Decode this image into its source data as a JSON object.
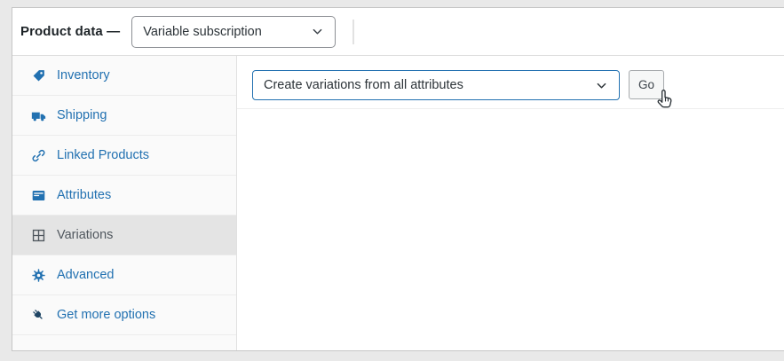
{
  "header": {
    "title": "Product data —",
    "product_type_select": {
      "value": "Variable subscription",
      "icon": "chevron-down-icon"
    }
  },
  "sidebar": {
    "items": [
      {
        "label": "Inventory",
        "icon": "tag-icon",
        "active": false
      },
      {
        "label": "Shipping",
        "icon": "truck-icon",
        "active": false
      },
      {
        "label": "Linked Products",
        "icon": "link-icon",
        "active": false
      },
      {
        "label": "Attributes",
        "icon": "form-card-icon",
        "active": false
      },
      {
        "label": "Variations",
        "icon": "grid-icon",
        "active": true
      },
      {
        "label": "Advanced",
        "icon": "gear-icon",
        "active": false
      },
      {
        "label": "Get more options",
        "icon": "plug-icon",
        "active": false
      }
    ]
  },
  "main": {
    "action_select": {
      "value": "Create variations from all attributes",
      "icon": "chevron-down-icon"
    },
    "go_button": "Go",
    "cursor_icon": "pointer-hand-icon"
  },
  "colors": {
    "accent_blue": "#2271b1",
    "link_blue": "#2271b1",
    "active_tab_bg": "#e4e4e4",
    "active_tab_text": "#50575e",
    "sidebar_bg": "#fafafa",
    "panel_bg": "#ffffff",
    "page_bg": "#e9e9e9",
    "panel_border": "#c6c6c6",
    "header_select_border": "#8c8f94",
    "button_bg": "#f6f7f7",
    "button_border": "#a7aaad",
    "text_dark": "#1d2327"
  }
}
